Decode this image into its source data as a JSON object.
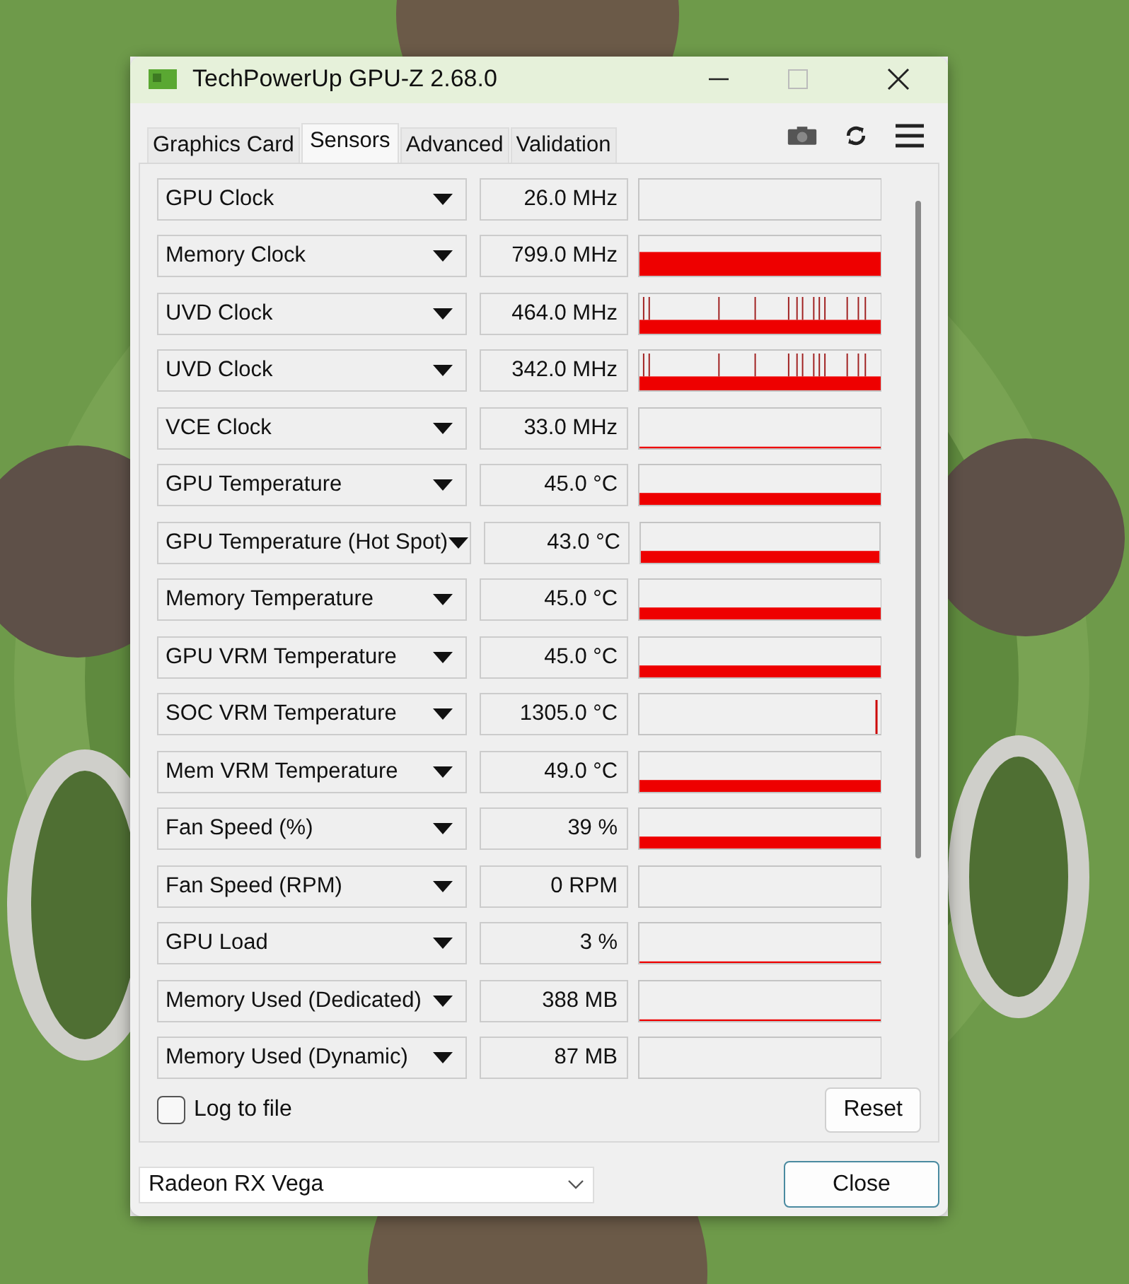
{
  "window": {
    "title": "TechPowerUp GPU-Z 2.68.0"
  },
  "tabs": [
    {
      "label": "Graphics Card",
      "selected": false
    },
    {
      "label": "Sensors",
      "selected": true
    },
    {
      "label": "Advanced",
      "selected": false
    },
    {
      "label": "Validation",
      "selected": false
    }
  ],
  "sensors": [
    {
      "name": "GPU Clock",
      "value": "26.0 MHz",
      "kind": "empty"
    },
    {
      "name": "Memory Clock",
      "value": "799.0 MHz",
      "kind": "high"
    },
    {
      "name": "UVD Clock",
      "value": "464.0 MHz",
      "kind": "spikes"
    },
    {
      "name": "UVD Clock",
      "value": "342.0 MHz",
      "kind": "spikes"
    },
    {
      "name": "VCE Clock",
      "value": "33.0 MHz",
      "kind": "flat"
    },
    {
      "name": "GPU Temperature",
      "value": "45.0 °C",
      "kind": "low"
    },
    {
      "name": "GPU Temperature (Hot Spot)",
      "value": "43.0 °C",
      "kind": "low"
    },
    {
      "name": "Memory Temperature",
      "value": "45.0 °C",
      "kind": "low"
    },
    {
      "name": "GPU VRM Temperature",
      "value": "45.0 °C",
      "kind": "low"
    },
    {
      "name": "SOC VRM Temperature",
      "value": "1305.0 °C",
      "kind": "spike"
    },
    {
      "name": "Mem VRM Temperature",
      "value": "49.0 °C",
      "kind": "low"
    },
    {
      "name": "Fan Speed (%)",
      "value": "39 %",
      "kind": "low"
    },
    {
      "name": "Fan Speed (RPM)",
      "value": "0 RPM",
      "kind": "empty"
    },
    {
      "name": "GPU Load",
      "value": "3 %",
      "kind": "flat"
    },
    {
      "name": "Memory Used (Dedicated)",
      "value": "388 MB",
      "kind": "flat"
    },
    {
      "name": "Memory Used (Dynamic)",
      "value": "87 MB",
      "kind": "empty"
    }
  ],
  "log_to_file": {
    "label": "Log to file",
    "checked": false
  },
  "reset_button": "Reset",
  "gpu_select": {
    "value": "Radeon RX Vega"
  },
  "close_button": "Close"
}
